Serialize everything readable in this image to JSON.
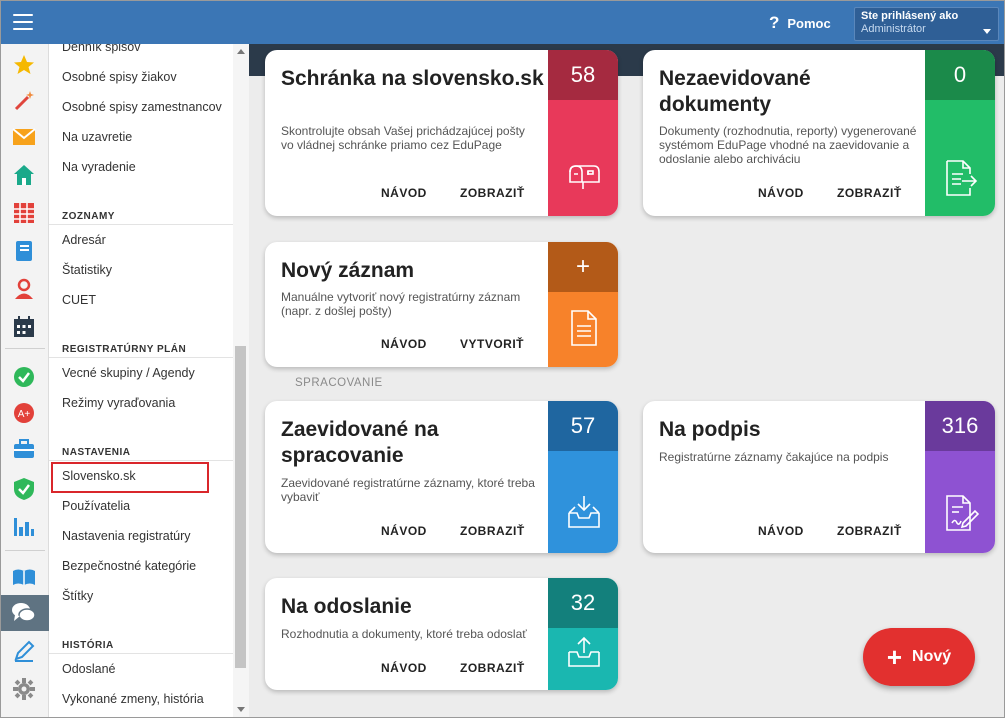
{
  "topbar": {
    "menu_icon": "hamburger-icon",
    "help_label": "Pomoc",
    "user_label": "Ste prihlásený ako",
    "user_role": "Administrátor"
  },
  "rail_icons": [
    "star-icon",
    "magic-wand-icon",
    "mail-icon",
    "home-icon",
    "calendar-grid-icon",
    "notebook-icon",
    "user-icon",
    "calendar-icon",
    "check-circle-icon",
    "grade-icon",
    "briefcase-icon",
    "shield-check-icon",
    "bar-chart-icon",
    "book-icon",
    "chat-icon",
    "pen-icon",
    "gear-icon"
  ],
  "menu": {
    "items_top": [
      "Denník spisov",
      "Osobné spisy žiakov",
      "Osobné spisy zamestnancov",
      "Na uzavretie",
      "Na vyradenie"
    ],
    "section_zoznamy": "ZOZNAMY",
    "items_zoznamy": [
      "Adresár",
      "Štatistiky",
      "CUET"
    ],
    "section_plan": "REGISTRATÚRNY PLÁN",
    "items_plan": [
      "Vecné skupiny / Agendy",
      "Režimy vyraďovania"
    ],
    "section_nastavenia": "NASTAVENIA",
    "items_nastavenia": [
      "Slovensko.sk",
      "Používatelia",
      "Nastavenia registratúry",
      "Bezpečnostné kategórie",
      "Štítky"
    ],
    "section_historia": "HISTÓRIA",
    "items_historia": [
      "Odoslané",
      "Vykonané zmeny, história"
    ]
  },
  "cards": {
    "schranka": {
      "title": "Schránka na slovensko.sk",
      "desc": "Skontrolujte obsah Vašej prichádzajúcej pošty vo vládnej schránke priamo cez EduPage",
      "count": "58",
      "link1": "NÁVOD",
      "link2": "ZOBRAZIŤ",
      "icon": "mailbox-icon",
      "color_top": "#a52a40",
      "color_bottom": "#e8395a"
    },
    "nezaevidovane": {
      "title": "Nezaevidované dokumenty",
      "desc": "Dokumenty (rozhodnutia, reporty) vygenerované systémom EduPage vhodné na zaevidovanie a odoslanie alebo archiváciu",
      "count": "0",
      "link1": "NÁVOD",
      "link2": "ZOBRAZIŤ",
      "icon": "document-export-icon",
      "color_top": "#1b8a4a",
      "color_bottom": "#22bd68"
    },
    "novy": {
      "title": "Nový záznam",
      "desc": "Manuálne vytvoriť nový registratúrny záznam (napr. z došlej pošty)",
      "count": "+",
      "link1": "NÁVOD",
      "link2": "VYTVORIŤ",
      "icon": "document-icon",
      "color_top": "#b35a18",
      "color_bottom": "#f7822a"
    },
    "zaevidovane": {
      "title": "Zaevidované na spracovanie",
      "desc": "Zaevidované registratúrne záznamy, ktoré treba vybaviť",
      "count": "57",
      "link1": "NÁVOD",
      "link2": "ZOBRAZIŤ",
      "icon": "inbox-download-icon",
      "color_top": "#1f66a0",
      "color_bottom": "#2f92dc"
    },
    "podpis": {
      "title": "Na podpis",
      "desc": "Registratúrne záznamy čakajúce na podpis",
      "count": "316",
      "link1": "NÁVOD",
      "link2": "ZOBRAZIŤ",
      "icon": "sign-document-icon",
      "color_top": "#6a3a9c",
      "color_bottom": "#8e52d2"
    },
    "odoslanie": {
      "title": "Na odoslanie",
      "desc": "Rozhodnutia a dokumenty, ktoré treba odoslať",
      "count": "32",
      "link1": "NÁVOD",
      "link2": "ZOBRAZIŤ",
      "icon": "inbox-upload-icon",
      "color_top": "#13807c",
      "color_bottom": "#1ab7b0"
    }
  },
  "section_label": "SPRACOVANIE",
  "fab": {
    "icon": "plus-icon",
    "label": "Nový"
  }
}
